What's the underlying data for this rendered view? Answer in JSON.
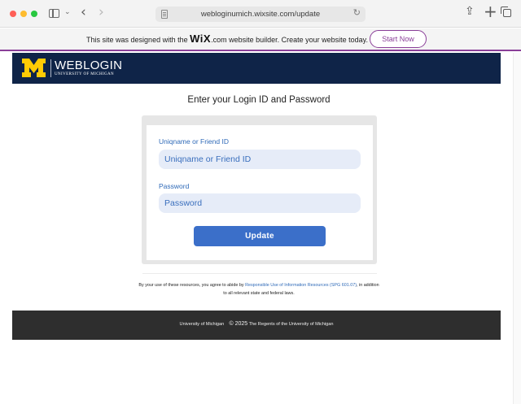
{
  "browser": {
    "url": "webloginumich.wixsite.com/update",
    "back_glyph": "‹",
    "forward_glyph": "›",
    "chevron_glyph": "⌄",
    "reload_glyph": "↻",
    "share_glyph": "⇪",
    "plus_glyph": "+"
  },
  "wix_banner": {
    "text_before": "This site was designed with the ",
    "logo": "WiX",
    "text_after": ".com website builder. Create your website today.",
    "button_label": "Start Now",
    "accent_color": "#8a3f98"
  },
  "header": {
    "logo_letter": "M",
    "title": "WEBLOGIN",
    "subtitle": "UNIVERSITY OF MICHIGAN",
    "bg_color": "#0f2448",
    "logo_color": "#ffcb05"
  },
  "login": {
    "heading": "Enter your Login ID and Password",
    "username_label": "Uniqname or Friend ID",
    "username_placeholder": "Uniqname or Friend ID",
    "password_label": "Password",
    "password_placeholder": "Password",
    "submit_label": "Update"
  },
  "terms": {
    "text_before": "By your use of these resources, you agree to abide by ",
    "link_text": "Responsible Use of Information Resources (SPG 601.07)",
    "text_after": ", in addition to all relevant state and federal laws."
  },
  "footer": {
    "org": "University of Michigan",
    "copyright_prefix": "© 2025",
    "copyright_rest": "The Regents of the University of Michigan"
  }
}
